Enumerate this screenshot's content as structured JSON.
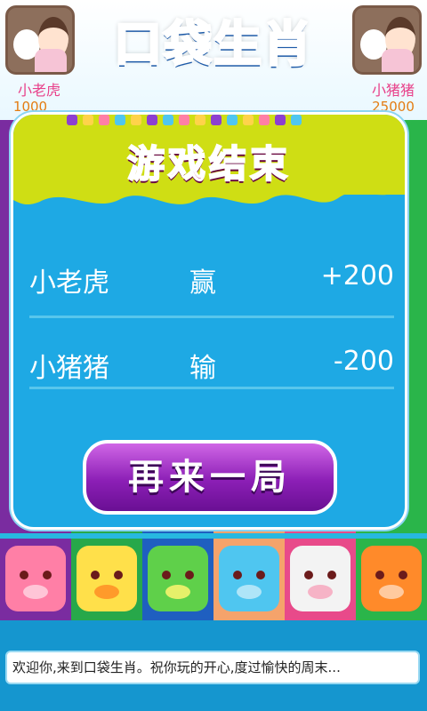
{
  "logo": {
    "chars": [
      "口",
      "袋",
      "生",
      "肖"
    ],
    "colors": [
      "#1f78d1",
      "#e84a8a",
      "#2ab54a",
      "#8f2fc6"
    ]
  },
  "players": [
    {
      "name": "小老虎",
      "score": "1000"
    },
    {
      "name": "小猪猪",
      "score": "25000"
    }
  ],
  "dialog": {
    "title": "游戏结束",
    "results": [
      {
        "name": "小老虎",
        "result": "赢",
        "score_change": "+200"
      },
      {
        "name": "小猪猪",
        "result": "输",
        "score_change": "-200"
      }
    ],
    "again_button": "再来一局"
  },
  "stripe_colors": [
    "#7a2ca0",
    "#27a84a",
    "#1f5fc0",
    "#f5a36b",
    "#e84a8a",
    "#2ab54a"
  ],
  "animals": [
    {
      "icon": "pig-icon",
      "color": "#ff7fa6"
    },
    {
      "icon": "chick-icon",
      "color": "#ffe04a"
    },
    {
      "icon": "dragon-icon",
      "color": "#5fd04a"
    },
    {
      "icon": "dog-icon",
      "color": "#4fc6f0"
    },
    {
      "icon": "cow-icon",
      "color": "#f3f3f3"
    },
    {
      "icon": "tiger-icon",
      "color": "#ff8a2a"
    }
  ],
  "marquee_text": "欢迎你,来到口袋生肖。祝你玩的开心,度过愉快的周末..."
}
